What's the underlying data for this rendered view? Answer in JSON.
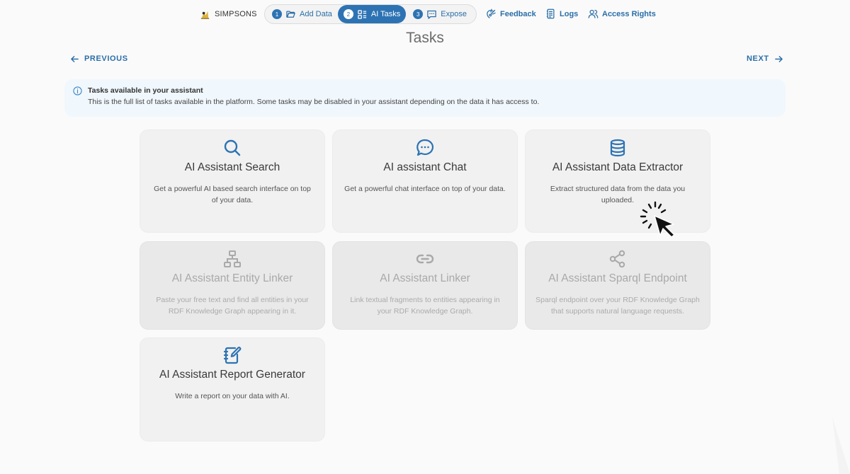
{
  "brand": {
    "name": "SIMPSONS"
  },
  "steps": [
    {
      "num": "1",
      "label": "Add Data",
      "icon": "folder-icon"
    },
    {
      "num": "2",
      "label": "AI Tasks",
      "icon": "tasks-icon",
      "active": true
    },
    {
      "num": "3",
      "label": "Expose",
      "icon": "message-icon"
    }
  ],
  "nav": {
    "feedback": "Feedback",
    "logs": "Logs",
    "access": "Access Rights"
  },
  "page": {
    "title": "Tasks",
    "previous": "PREVIOUS",
    "next": "NEXT"
  },
  "info": {
    "title": "Tasks available in your assistant",
    "text": "This is the full list of tasks available in the platform. Some tasks may be disabled in your assistant depending on the data it has access to."
  },
  "tasks": [
    {
      "title": "AI Assistant Search",
      "desc": "Get a powerful AI based search interface on top of your data.",
      "icon": "search-icon",
      "enabled": true
    },
    {
      "title": "AI assistant Chat",
      "desc": "Get a powerful chat interface on top of your data.",
      "icon": "chat-icon",
      "enabled": true
    },
    {
      "title": "AI Assistant Data Extractor",
      "desc": "Extract structured data from the data you uploaded.",
      "icon": "database-icon",
      "enabled": true
    },
    {
      "title": "AI Assistant Entity Linker",
      "desc": "Paste your free text and find all entities in your RDF Knowledge Graph appearing in it.",
      "icon": "hierarchy-icon",
      "enabled": false
    },
    {
      "title": "AI Assistant Linker",
      "desc": "Link textual fragments to entities appearing in your RDF Knowledge Graph.",
      "icon": "link-icon",
      "enabled": false
    },
    {
      "title": "AI Assistant Sparql Endpoint",
      "desc": "Sparql endpoint over your RDF Knowledge Graph that supports natural language requests.",
      "icon": "share-icon",
      "enabled": false
    },
    {
      "title": "AI Assistant Report Generator",
      "desc": "Write a report on your data with AI.",
      "icon": "report-icon",
      "enabled": true
    }
  ],
  "colors": {
    "accent": "#2d73b3",
    "info_bg": "#f0f7fd",
    "card_bg": "#f1f1f1",
    "disabled_text": "#a9a9a9"
  }
}
